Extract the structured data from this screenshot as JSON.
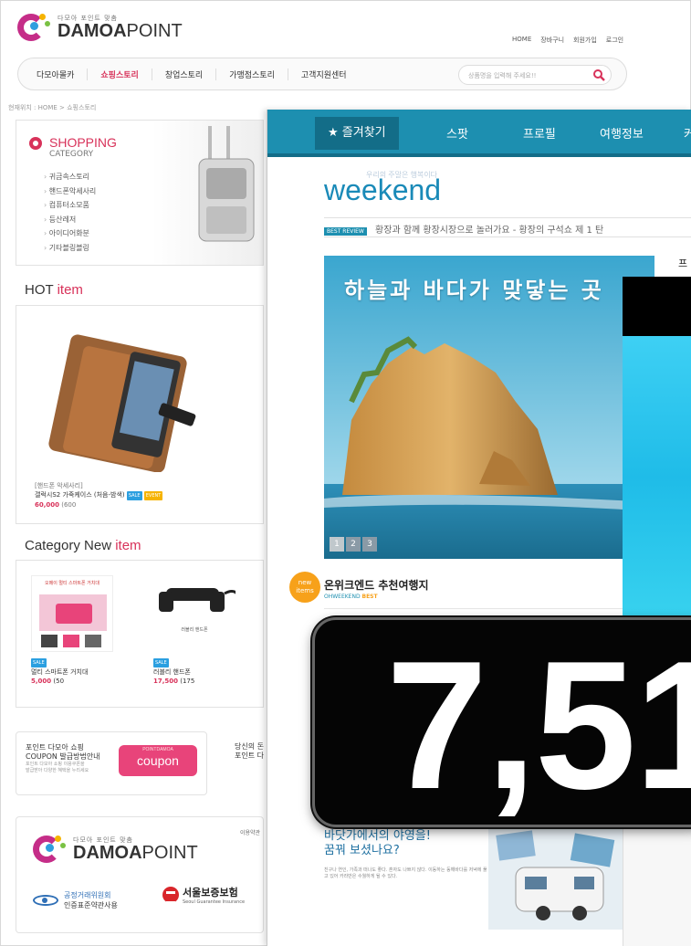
{
  "back": {
    "logo": {
      "tagline": "다모아 포인트 맞춤",
      "brand_bold": "DAMOA",
      "brand_light": "POINT"
    },
    "toplinks": [
      "HOME",
      "장바구니",
      "회원가입",
      "로그인"
    ],
    "nav": [
      "다모아몰카",
      "쇼핑스토리",
      "창업스토리",
      "가맹점스토리",
      "고객지원센터"
    ],
    "search": {
      "placeholder": "상품명을 입력해 주세요!!"
    },
    "breadcrumb": "현재위치 : HOME > 쇼핑스토리",
    "category": {
      "title": "SHOPPING",
      "subtitle": "CATEGORY",
      "items": [
        "귀금속스토리",
        "핸드폰악세사리",
        "컴퓨터소모품",
        "등산레저",
        "아이디어화분",
        "기타블링블링"
      ]
    },
    "hot": {
      "title_a": "HOT ",
      "title_b": "item",
      "category": "[핸드폰 악세사리]",
      "name": "갤럭시S2 가죽케이스 (처음-밤색)",
      "badge1": "SALE",
      "badge2": "EVENT",
      "price": "60,000",
      "points": "(600",
      "badge1_color": "#2b9fe0",
      "badge2_color": "#f6b300"
    },
    "category_new": {
      "title_a": "Category New ",
      "title_b": "item",
      "items": [
        {
          "badge": "SALE",
          "name": "멀티 스마트폰 거치대",
          "price": "5,000",
          "points": "(50",
          "thumb_caption": "오메이 멀티 스마트폰 거치대"
        },
        {
          "badge": "SALE",
          "name": "러블리 핸드폰",
          "price": "17,500",
          "points": "(175",
          "thumb_caption": "러블리 핸드폰"
        }
      ]
    },
    "coupon": {
      "line1": "포인트 다모아 쇼핑",
      "line2": "COUPON 발급방법안내",
      "fine1": "포인트 다모아 쇼핑 이용쿠폰을",
      "fine2": "발급받아 다양한 혜택을 누리세요",
      "button_small": "POINTDAMOA",
      "button": "coupon"
    },
    "point2": {
      "line1": "당신의 돈",
      "line2": "포인트 다"
    },
    "footer": {
      "ftc_line1": "공정거래위원회",
      "ftc_line2": "인증표준약관사용",
      "sgi": "서울보증보험",
      "sgi_sub": "Seoul Guarantee Insurance",
      "right_label": "이용약관"
    }
  },
  "front": {
    "nav": [
      "★ 즐겨찾기",
      "스팟",
      "프로필",
      "여행정보",
      "커"
    ],
    "logo_kr": "우리의 주말은 행복이다",
    "logo": "weekend",
    "ticker_tag": "BEST REVIEW",
    "ticker_text": "황장과 함께 황장시장으로 놀러가요 - 황장의 구석쇼 제 1 탄",
    "hero_title": "하늘과 바다가 맞닿는 곳",
    "pager": [
      "1",
      "2",
      "3"
    ],
    "side_label": "프",
    "new_badge_1": "new",
    "new_badge_2": "items",
    "sec_title": "온위크엔드 추천여행지",
    "sec_sub_a": "OHWEEKEND ",
    "sec_sub_b": "BEST",
    "camp_head_1": "바닷가에서의 야영을!",
    "camp_head_2": "꿈꿔 보셨나요?",
    "camp_text": "친구나 연인, 가족과 떠나도 좋다. 혼자도 나쁘지 않다. 이동하는 동해바다를 저녁에 풀고 있어 카라반은 수월하게 될 수 있다."
  },
  "overlay": {
    "counter_value": "7,51",
    "black": "#000000",
    "cyan": "#1fbce8"
  }
}
